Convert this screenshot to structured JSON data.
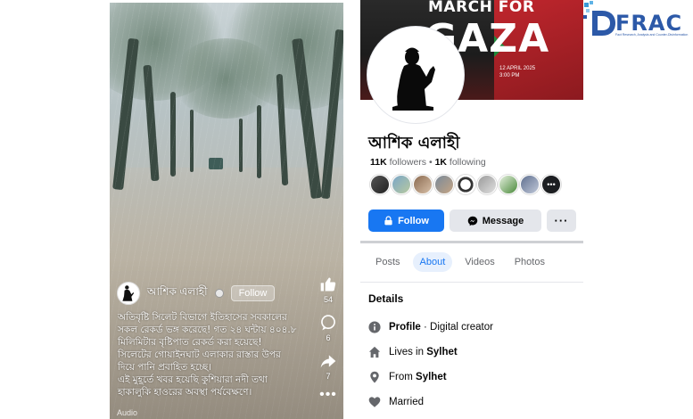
{
  "video": {
    "author_name": "আশিক এলাহী",
    "follow_label": "Follow",
    "caption": "অতিবৃষ্টি সিলেট বিভাগে ইতিহাসের সবকালের\nসকল রেকর্ড ভঙ্গ করেছে! গত ২৪ ঘন্টায় ৪০৪.৮\nমিলিমিটার বৃষ্টিপাত রেকর্ড করা হয়েছে!\nসিলেটের গোয়াইনঘাট এলাকার রাস্তার উপর\nদিয়ে পানি প্রবাহিত হচ্ছে।\nএই মুহূর্তে খবর হয়েছি কুশিয়ারা নদী তথা\nহাকালুকি হাওরের অবস্থা পর্যবেক্ষণে।",
    "bottom_text": "Audio",
    "likes": "54",
    "comments": "6",
    "shares": "7",
    "icons": [
      "like-icon",
      "comment-icon",
      "share-icon",
      "more-icon"
    ]
  },
  "profile": {
    "cover": {
      "title_line1": "MARCH FOR",
      "title_line2": "GAZA",
      "date_line1": "12 APRIL 2025",
      "date_line2": "3:00 PM"
    },
    "name": "আশিক এলাহী",
    "followers_count": "11K",
    "followers_label": " followers",
    "separator": " • ",
    "following_count": "1K",
    "following_label": " following",
    "follow_button": "Follow",
    "message_button": "Message",
    "more_button": "···",
    "tabs": [
      "Posts",
      "About",
      "Videos",
      "Photos"
    ],
    "active_tab": "About",
    "details_heading": "Details",
    "details": {
      "profile_label": "Profile",
      "profile_value": " · Digital creator",
      "lives_prefix": "Lives in ",
      "lives_value": "Sylhet",
      "from_prefix": "From ",
      "from_value": "Sylhet",
      "relationship": "Married"
    },
    "colors": {
      "primary": "#1877f2",
      "secondary_button": "#e4e6eb",
      "text": "#050505",
      "muted": "#65676b"
    }
  },
  "logo": {
    "text": "FRAC",
    "subtitle": "Fact Research, Analysis and Counter-Disinformation"
  }
}
